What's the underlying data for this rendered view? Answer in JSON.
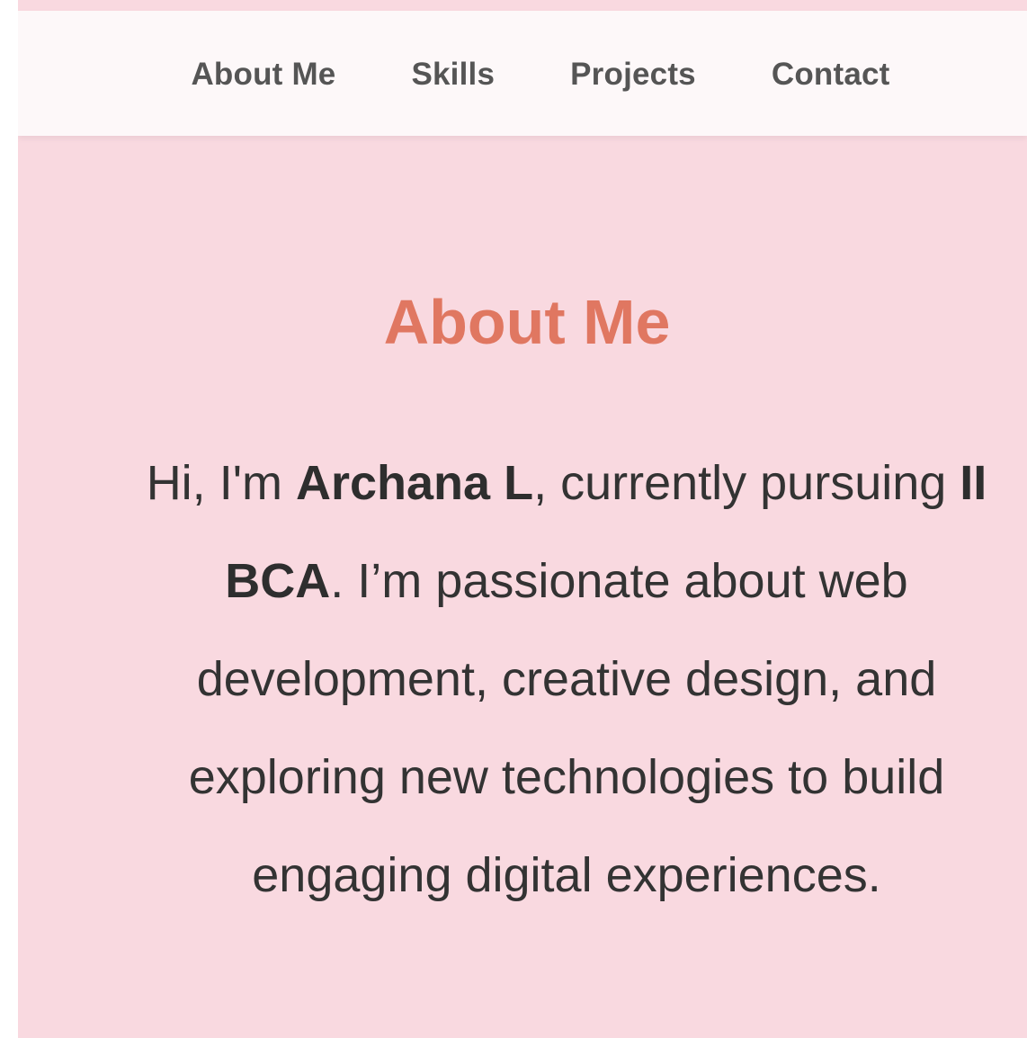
{
  "nav": {
    "items": [
      {
        "label": "About Me"
      },
      {
        "label": "Skills"
      },
      {
        "label": "Projects"
      },
      {
        "label": "Contact"
      }
    ]
  },
  "about": {
    "title": "About Me",
    "intro": "Hi, I'm ",
    "name": "Archana L",
    "mid": ", currently pursuing ",
    "course": "II BCA",
    "rest": ". I’m passionate about web development, creative design, and exploring new technologies to build engaging digital experiences."
  },
  "colors": {
    "background": "#f9d9e0",
    "navbar": "#fdf8f9",
    "accent": "#e07761",
    "text": "#333333"
  }
}
